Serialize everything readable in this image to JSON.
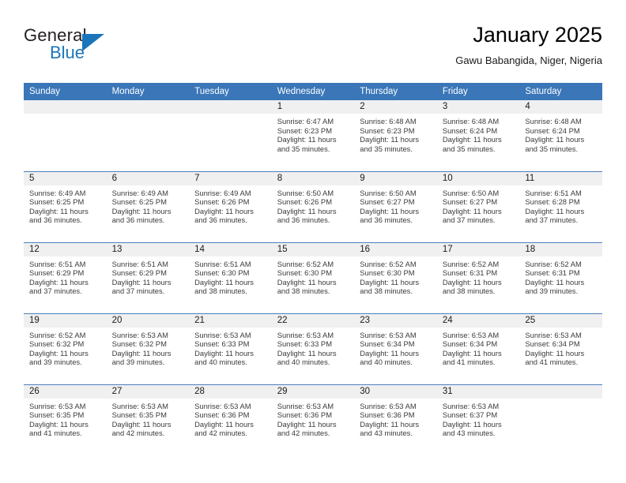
{
  "brand": {
    "name_top": "General",
    "name_bottom": "Blue",
    "triangle_icon": "blue-triangle-icon",
    "color_dark": "#231f20",
    "color_blue": "#1b75bb"
  },
  "header": {
    "title": "January 2025",
    "subtitle": "Gawu Babangida, Niger, Nigeria"
  },
  "theme": {
    "header_bg": "#3a76b8",
    "daynum_bg": "#f0f0f0",
    "row_border": "#4a7fbd",
    "text": "#3b3b3b"
  },
  "calendar": {
    "weekday_headers": [
      "Sunday",
      "Monday",
      "Tuesday",
      "Wednesday",
      "Thursday",
      "Friday",
      "Saturday"
    ],
    "labels": {
      "sunrise": "Sunrise:",
      "sunset": "Sunset:",
      "daylight": "Daylight:"
    },
    "weeks": [
      [
        {
          "day": "",
          "empty": true
        },
        {
          "day": "",
          "empty": true
        },
        {
          "day": "",
          "empty": true
        },
        {
          "day": "1",
          "sunrise": "Sunrise: 6:47 AM",
          "sunset": "Sunset: 6:23 PM",
          "daylight": "Daylight: 11 hours and 35 minutes."
        },
        {
          "day": "2",
          "sunrise": "Sunrise: 6:48 AM",
          "sunset": "Sunset: 6:23 PM",
          "daylight": "Daylight: 11 hours and 35 minutes."
        },
        {
          "day": "3",
          "sunrise": "Sunrise: 6:48 AM",
          "sunset": "Sunset: 6:24 PM",
          "daylight": "Daylight: 11 hours and 35 minutes."
        },
        {
          "day": "4",
          "sunrise": "Sunrise: 6:48 AM",
          "sunset": "Sunset: 6:24 PM",
          "daylight": "Daylight: 11 hours and 35 minutes."
        }
      ],
      [
        {
          "day": "5",
          "sunrise": "Sunrise: 6:49 AM",
          "sunset": "Sunset: 6:25 PM",
          "daylight": "Daylight: 11 hours and 36 minutes."
        },
        {
          "day": "6",
          "sunrise": "Sunrise: 6:49 AM",
          "sunset": "Sunset: 6:25 PM",
          "daylight": "Daylight: 11 hours and 36 minutes."
        },
        {
          "day": "7",
          "sunrise": "Sunrise: 6:49 AM",
          "sunset": "Sunset: 6:26 PM",
          "daylight": "Daylight: 11 hours and 36 minutes."
        },
        {
          "day": "8",
          "sunrise": "Sunrise: 6:50 AM",
          "sunset": "Sunset: 6:26 PM",
          "daylight": "Daylight: 11 hours and 36 minutes."
        },
        {
          "day": "9",
          "sunrise": "Sunrise: 6:50 AM",
          "sunset": "Sunset: 6:27 PM",
          "daylight": "Daylight: 11 hours and 36 minutes."
        },
        {
          "day": "10",
          "sunrise": "Sunrise: 6:50 AM",
          "sunset": "Sunset: 6:27 PM",
          "daylight": "Daylight: 11 hours and 37 minutes."
        },
        {
          "day": "11",
          "sunrise": "Sunrise: 6:51 AM",
          "sunset": "Sunset: 6:28 PM",
          "daylight": "Daylight: 11 hours and 37 minutes."
        }
      ],
      [
        {
          "day": "12",
          "sunrise": "Sunrise: 6:51 AM",
          "sunset": "Sunset: 6:29 PM",
          "daylight": "Daylight: 11 hours and 37 minutes."
        },
        {
          "day": "13",
          "sunrise": "Sunrise: 6:51 AM",
          "sunset": "Sunset: 6:29 PM",
          "daylight": "Daylight: 11 hours and 37 minutes."
        },
        {
          "day": "14",
          "sunrise": "Sunrise: 6:51 AM",
          "sunset": "Sunset: 6:30 PM",
          "daylight": "Daylight: 11 hours and 38 minutes."
        },
        {
          "day": "15",
          "sunrise": "Sunrise: 6:52 AM",
          "sunset": "Sunset: 6:30 PM",
          "daylight": "Daylight: 11 hours and 38 minutes."
        },
        {
          "day": "16",
          "sunrise": "Sunrise: 6:52 AM",
          "sunset": "Sunset: 6:30 PM",
          "daylight": "Daylight: 11 hours and 38 minutes."
        },
        {
          "day": "17",
          "sunrise": "Sunrise: 6:52 AM",
          "sunset": "Sunset: 6:31 PM",
          "daylight": "Daylight: 11 hours and 38 minutes."
        },
        {
          "day": "18",
          "sunrise": "Sunrise: 6:52 AM",
          "sunset": "Sunset: 6:31 PM",
          "daylight": "Daylight: 11 hours and 39 minutes."
        }
      ],
      [
        {
          "day": "19",
          "sunrise": "Sunrise: 6:52 AM",
          "sunset": "Sunset: 6:32 PM",
          "daylight": "Daylight: 11 hours and 39 minutes."
        },
        {
          "day": "20",
          "sunrise": "Sunrise: 6:53 AM",
          "sunset": "Sunset: 6:32 PM",
          "daylight": "Daylight: 11 hours and 39 minutes."
        },
        {
          "day": "21",
          "sunrise": "Sunrise: 6:53 AM",
          "sunset": "Sunset: 6:33 PM",
          "daylight": "Daylight: 11 hours and 40 minutes."
        },
        {
          "day": "22",
          "sunrise": "Sunrise: 6:53 AM",
          "sunset": "Sunset: 6:33 PM",
          "daylight": "Daylight: 11 hours and 40 minutes."
        },
        {
          "day": "23",
          "sunrise": "Sunrise: 6:53 AM",
          "sunset": "Sunset: 6:34 PM",
          "daylight": "Daylight: 11 hours and 40 minutes."
        },
        {
          "day": "24",
          "sunrise": "Sunrise: 6:53 AM",
          "sunset": "Sunset: 6:34 PM",
          "daylight": "Daylight: 11 hours and 41 minutes."
        },
        {
          "day": "25",
          "sunrise": "Sunrise: 6:53 AM",
          "sunset": "Sunset: 6:34 PM",
          "daylight": "Daylight: 11 hours and 41 minutes."
        }
      ],
      [
        {
          "day": "26",
          "sunrise": "Sunrise: 6:53 AM",
          "sunset": "Sunset: 6:35 PM",
          "daylight": "Daylight: 11 hours and 41 minutes."
        },
        {
          "day": "27",
          "sunrise": "Sunrise: 6:53 AM",
          "sunset": "Sunset: 6:35 PM",
          "daylight": "Daylight: 11 hours and 42 minutes."
        },
        {
          "day": "28",
          "sunrise": "Sunrise: 6:53 AM",
          "sunset": "Sunset: 6:36 PM",
          "daylight": "Daylight: 11 hours and 42 minutes."
        },
        {
          "day": "29",
          "sunrise": "Sunrise: 6:53 AM",
          "sunset": "Sunset: 6:36 PM",
          "daylight": "Daylight: 11 hours and 42 minutes."
        },
        {
          "day": "30",
          "sunrise": "Sunrise: 6:53 AM",
          "sunset": "Sunset: 6:36 PM",
          "daylight": "Daylight: 11 hours and 43 minutes."
        },
        {
          "day": "31",
          "sunrise": "Sunrise: 6:53 AM",
          "sunset": "Sunset: 6:37 PM",
          "daylight": "Daylight: 11 hours and 43 minutes."
        },
        {
          "day": "",
          "empty": true
        }
      ]
    ]
  }
}
